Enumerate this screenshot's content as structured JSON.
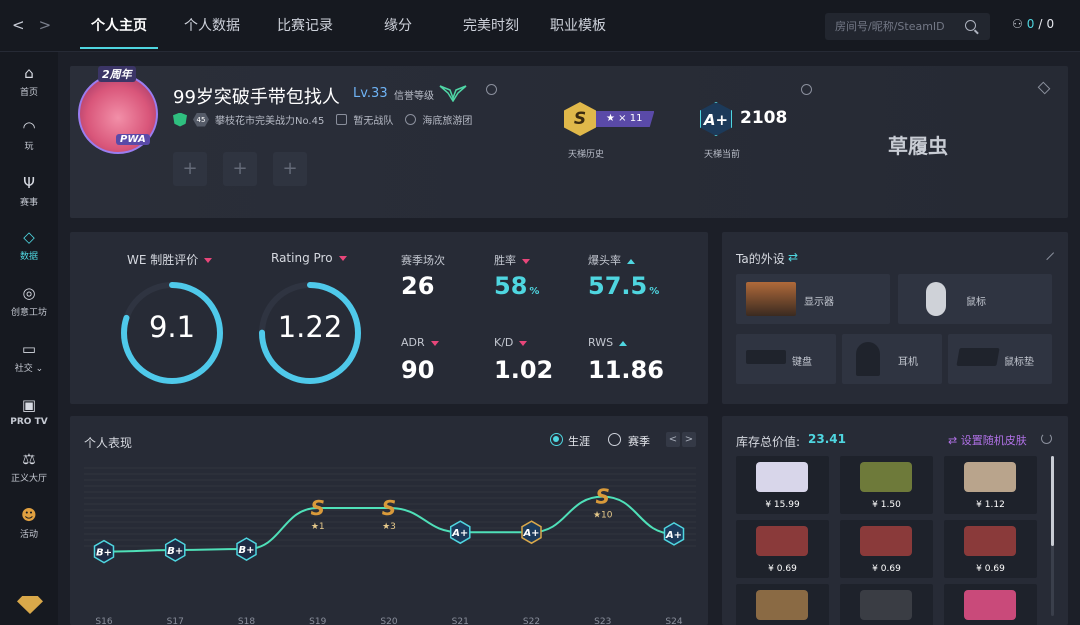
{
  "nav": {
    "back": "<",
    "forward": ">"
  },
  "tabs": [
    "个人主页",
    "个人数据",
    "比赛记录",
    "缘分",
    "完美时刻",
    "职业模板"
  ],
  "search": {
    "placeholder": "房间号/昵称/SteamID"
  },
  "user_count": {
    "a": "0",
    "sep": "/",
    "b": "0"
  },
  "sidebar": [
    {
      "label": "首页",
      "icon": "home-icon"
    },
    {
      "label": "玩",
      "icon": "wifi-icon"
    },
    {
      "label": "赛事",
      "icon": "trophy-icon"
    },
    {
      "label": "数据",
      "icon": "data-diamond-icon"
    },
    {
      "label": "创意工坊",
      "icon": "planet-icon"
    },
    {
      "label": "社交",
      "icon": "chat-icon"
    },
    {
      "label": "PRO TV",
      "icon": "tv-icon"
    },
    {
      "label": "正义大厅",
      "icon": "scales-icon"
    },
    {
      "label": "活动",
      "icon": "mascot-icon"
    }
  ],
  "profile": {
    "badge_top": "2周年",
    "badge_bottom": "PWA",
    "username": "99岁突破手带包找人",
    "level": "Lv.33",
    "credit_label": "信誉等级",
    "power_level": "45",
    "power_text": "攀枝花市完美战力No.45",
    "team_text": "暂无战队",
    "club_text": "海底旅游团",
    "rank_history_letter": "S",
    "rank_history_stars": "★ × 11",
    "rank_history_label": "天梯历史",
    "rank_current_letter": "A+",
    "rank_current_score": "2108",
    "rank_current_label": "天梯当前",
    "nickname": "草履虫"
  },
  "stats": {
    "we_label": "WE 制胜评价",
    "we_value": "9.1",
    "we_fraction": 0.8,
    "rating_label": "Rating Pro",
    "rating_value": "1.22",
    "rating_fraction": 0.75,
    "matches_label": "赛季场次",
    "matches_value": "26",
    "winrate_label": "胜率",
    "winrate_value": "58",
    "winrate_unit": "%",
    "hs_label": "爆头率",
    "hs_value": "57.5",
    "hs_unit": "%",
    "adr_label": "ADR",
    "adr_value": "90",
    "kd_label": "K/D",
    "kd_value": "1.02",
    "rws_label": "RWS",
    "rws_value": "11.86"
  },
  "gear": {
    "title": "Ta的外设",
    "shuffle": "⇄",
    "items": [
      "显示器",
      "鼠标",
      "键盘",
      "耳机",
      "鼠标垫"
    ]
  },
  "performance": {
    "title": "个人表现",
    "radio_career": "生涯",
    "radio_season": "赛季",
    "prev": "<",
    "next": ">"
  },
  "chart_data": {
    "type": "line",
    "categories": [
      "S16",
      "S17",
      "S18",
      "S19",
      "S20",
      "S21",
      "S22",
      "S23",
      "S24"
    ],
    "ranks": [
      "B+",
      "B+",
      "B+",
      "S",
      "S",
      "A+",
      "A+",
      "S",
      "A+"
    ],
    "stars": [
      "",
      "",
      "",
      "★1",
      "★3",
      "",
      "",
      "★10",
      ""
    ],
    "values": [
      1,
      1.05,
      1.08,
      2.35,
      2.35,
      1.6,
      1.6,
      2.7,
      1.55
    ],
    "ylim": [
      0,
      3.4
    ]
  },
  "inventory": {
    "total_label": "库存总价值:",
    "total_value": "23.41",
    "random_label": "⇄ 设置随机皮肤",
    "items": [
      {
        "price": "¥ 15.99",
        "color": "#d8d6ea"
      },
      {
        "price": "¥ 1.50",
        "color": "#6e7a3a"
      },
      {
        "price": "¥ 1.12",
        "color": "#b9a48c"
      },
      {
        "price": "¥ 0.69",
        "color": "#8a3a3a"
      },
      {
        "price": "¥ 0.69",
        "color": "#8a3a3a"
      },
      {
        "price": "¥ 0.69",
        "color": "#8a3a3a"
      },
      {
        "price": "",
        "color": "#8a6a44"
      },
      {
        "price": "",
        "color": "#3a3d44"
      },
      {
        "price": "",
        "color": "#c94a7a"
      }
    ]
  },
  "colors": {
    "accent": "#4fd6e0",
    "down": "#e8467a",
    "purple": "#5a4aa8"
  }
}
